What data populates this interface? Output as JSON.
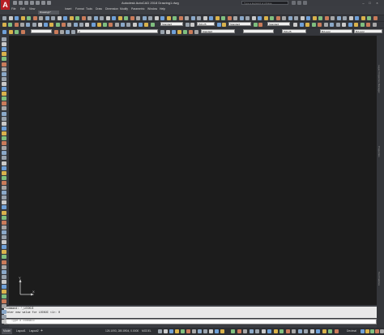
{
  "window": {
    "title": "Autodesk AutoCAD 2018    Drawing1.dwg",
    "app_logo": "A",
    "search_placeholder": "Type a keyword or phrase"
  },
  "menu": [
    "File",
    "Edit",
    "View",
    "Insert",
    "Format",
    "Tools",
    "Draw",
    "Dimension",
    "Modify",
    "Parametric",
    "Window",
    "Help"
  ],
  "file_tab": "Drawing1*",
  "toolbar_row2": {
    "text_style": "Standard",
    "dim_style": "ISO-25",
    "table_style": "Standard",
    "mleader_style": "Standard"
  },
  "toolbar_row3": {
    "layer_value": "0",
    "color_value": "ByLayer",
    "style_value": "Standard",
    "dim_value": "ISO-25",
    "linetype_value": "ByLayer"
  },
  "right_panel": [
    "Layer Properties Manager",
    "Properties",
    "Tool Palettes"
  ],
  "command": {
    "history": [
      "Command: '_LOCKUI",
      "Enter new value for LOCKUI <1>: 0"
    ],
    "placeholder": "Type a command"
  },
  "layout_tabs": [
    "Model",
    "Layout1",
    "Layout2"
  ],
  "status": {
    "coordinates": "126.1093, 280.8904, 0.0000",
    "space": "MODEL",
    "units": "Decimal"
  },
  "colors": {
    "canvas": "#1c1c1c",
    "chrome": "#3b3d42",
    "logo": "#b61e24"
  }
}
